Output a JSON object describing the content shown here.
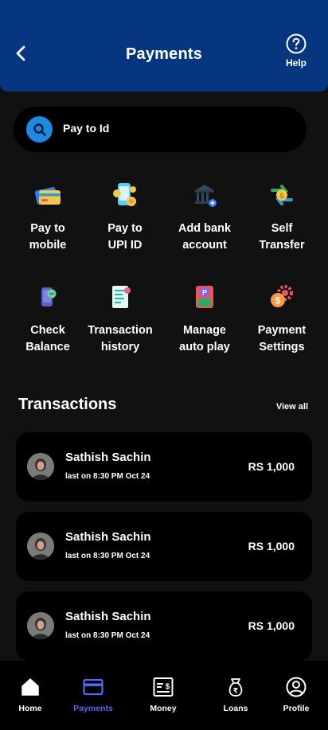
{
  "header": {
    "title": "Payments",
    "help_label": "Help"
  },
  "search": {
    "label": "Pay to Id"
  },
  "actions": [
    {
      "label": "Pay to\nmobile",
      "icon": "credit-card-icon"
    },
    {
      "label": "Pay to\nUPI ID",
      "icon": "phone-coins-icon"
    },
    {
      "label": "Add bank\naccount",
      "icon": "bank-icon"
    },
    {
      "label": "Self\nTransfer",
      "icon": "transfer-icon"
    },
    {
      "label": "Check\nBalance",
      "icon": "balance-phone-icon"
    },
    {
      "label": "Transaction\nhistory",
      "icon": "receipt-icon"
    },
    {
      "label": "Manage\nauto play",
      "icon": "autopay-icon"
    },
    {
      "label": "Payment\nSettings",
      "icon": "settings-coin-icon"
    }
  ],
  "transactions": {
    "title": "Transactions",
    "view_all": "View all",
    "items": [
      {
        "name": "Sathish Sachin",
        "time": "last on 8:30 PM Oct 24",
        "amount": "RS 1,000"
      },
      {
        "name": "Sathish Sachin",
        "time": "last on 8:30 PM Oct 24",
        "amount": "RS 1,000"
      },
      {
        "name": "Sathish Sachin",
        "time": "last on 8:30 PM Oct 24",
        "amount": "RS 1,000"
      }
    ]
  },
  "nav": [
    {
      "label": "Home",
      "icon": "home-icon",
      "active": false
    },
    {
      "label": "Payments",
      "icon": "card-icon",
      "active": true
    },
    {
      "label": "Money",
      "icon": "money-icon",
      "active": false
    },
    {
      "label": "Loans",
      "icon": "money-bag-icon",
      "active": false
    },
    {
      "label": "Profile",
      "icon": "profile-icon",
      "active": false
    }
  ],
  "colors": {
    "header": "#063680",
    "accent": "#4a6cf7",
    "search_icon_bg": "#1e88e5"
  }
}
